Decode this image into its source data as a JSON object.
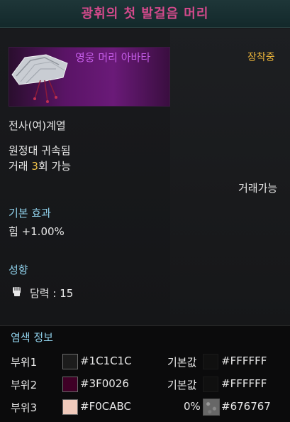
{
  "header": {
    "title": "광휘의 첫 발걸음 머리"
  },
  "item": {
    "name": "영웅 머리 아바타",
    "equipped": "장착중",
    "class_line": "전사(여)계열",
    "bound": "원정대 귀속됨",
    "trade_prefix": "거래 ",
    "trade_count": "3",
    "trade_suffix": "회 가능",
    "tradeable": "거래가능"
  },
  "base_effect": {
    "heading": "기본 효과",
    "value": "힘 +1.00%"
  },
  "tendency": {
    "heading": "성향",
    "label": "담력 : 15",
    "icon": "fist-icon"
  },
  "dye": {
    "heading": "염색 정보",
    "parts": [
      {
        "label": "부위1",
        "color": "#1C1C1C",
        "hex": "#1C1C1C",
        "base_label": "기본값",
        "base_hex": "#FFFFFF"
      },
      {
        "label": "부위2",
        "color": "#3F0026",
        "hex": "#3F0026",
        "base_label": "기본값",
        "base_hex": "#FFFFFF"
      },
      {
        "label": "부위3",
        "color": "#F0CABC",
        "hex": "#F0CABC",
        "pct": "0%",
        "base_hex": "#676767"
      }
    ]
  },
  "colors": {
    "title": "#d44a8c",
    "item_name": "#c35be6",
    "equipped": "#e8b23a",
    "section": "#8fd0ea"
  }
}
